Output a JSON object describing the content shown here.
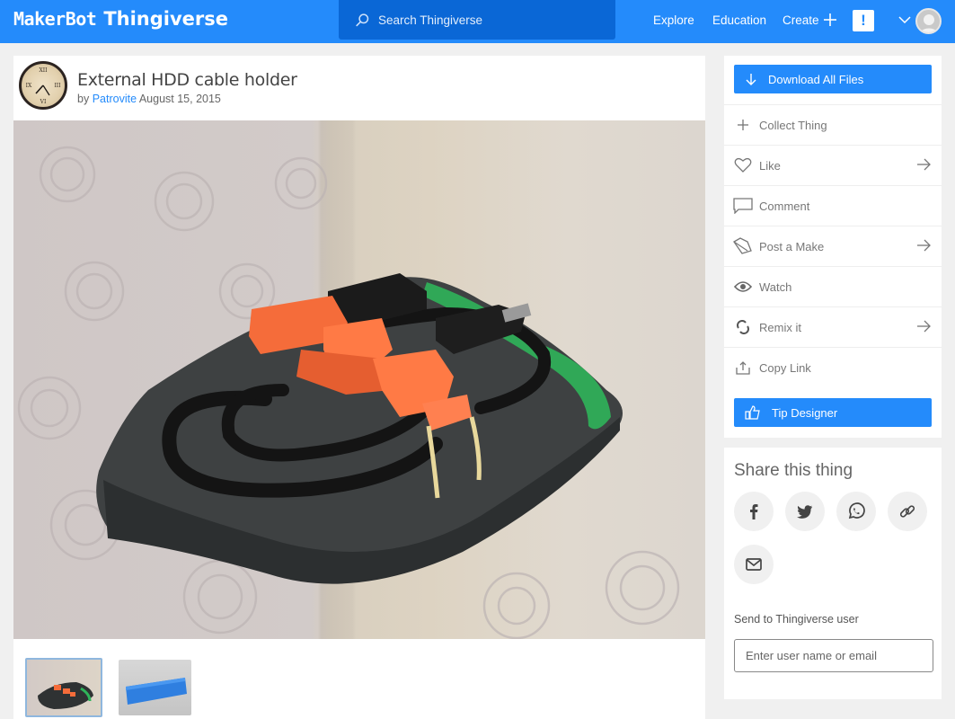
{
  "topbar": {
    "logo_makerbot": "MakerBot",
    "logo_thingiverse": "Thingiverse",
    "search_placeholder": "Search Thingiverse",
    "nav": [
      "Explore",
      "Education",
      "Create"
    ],
    "alert_glyph": "!",
    "brand_color": "#248bfb"
  },
  "thing": {
    "title": "External HDD cable holder",
    "by_prefix": "by",
    "author": "Patrovite",
    "date": "August 15, 2015",
    "thumbnails": [
      "photo-hdd-cable-holder",
      "render-blue-holder"
    ]
  },
  "sidebar": {
    "download_label": "Download All Files",
    "actions": [
      {
        "label": "Collect Thing",
        "icon": "plus-icon",
        "arrow": false
      },
      {
        "label": "Like",
        "icon": "heart-icon",
        "arrow": true
      },
      {
        "label": "Comment",
        "icon": "comment-icon",
        "arrow": false
      },
      {
        "label": "Post a Make",
        "icon": "make-icon",
        "arrow": true
      },
      {
        "label": "Watch",
        "icon": "eye-icon",
        "arrow": false
      },
      {
        "label": "Remix it",
        "icon": "remix-icon",
        "arrow": true
      },
      {
        "label": "Copy Link",
        "icon": "share-upload-icon",
        "arrow": false
      }
    ],
    "tip_label": "Tip Designer"
  },
  "share": {
    "title": "Share this thing",
    "buttons": [
      "facebook",
      "twitter",
      "whatsapp",
      "link",
      "email"
    ],
    "send_label": "Send to Thingiverse user",
    "send_placeholder": "Enter user name or email"
  }
}
